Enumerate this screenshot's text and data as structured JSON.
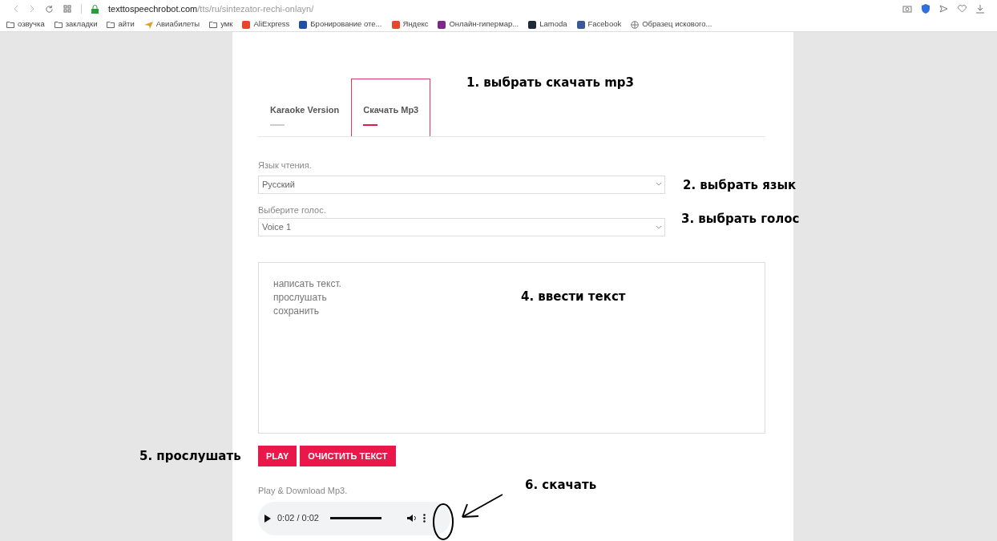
{
  "browser": {
    "url_host": "texttospeechrobot.com",
    "url_path": "/tts/ru/sintezator-rechi-onlayn/"
  },
  "bookmarks": [
    {
      "label": "озвучка",
      "kind": "folder"
    },
    {
      "label": "закладки",
      "kind": "folder"
    },
    {
      "label": "айти",
      "kind": "folder"
    },
    {
      "label": "Авиабилеты",
      "kind": "plane"
    },
    {
      "label": "умк",
      "kind": "folder"
    },
    {
      "label": "AliExpress",
      "kind": "site",
      "color": "#e8452c"
    },
    {
      "label": "Бронирование оте...",
      "kind": "site",
      "color": "#1e4fa3"
    },
    {
      "label": "Яндекс",
      "kind": "site",
      "color": "#e8452c"
    },
    {
      "label": "Онлайн-гипермар...",
      "kind": "site",
      "color": "#7b2a8c"
    },
    {
      "label": "Lamoda",
      "kind": "site",
      "color": "#1f2937"
    },
    {
      "label": "Facebook",
      "kind": "site",
      "color": "#3b5998"
    },
    {
      "label": "Образец искового...",
      "kind": "globe"
    }
  ],
  "tabs": [
    {
      "label": "Karaoke Version",
      "selected": false
    },
    {
      "label": "Скачать Mp3",
      "selected": true
    }
  ],
  "language": {
    "label": "Язык чтения.",
    "value": "Русский"
  },
  "voice": {
    "label": "Выберите голос.",
    "value": "Voice 1"
  },
  "text_area": {
    "value": "написать текст.\nпрослушать\nсохранить"
  },
  "buttons": [
    "PLAY",
    "ОЧИСТИТЬ ТЕКСТ"
  ],
  "player": {
    "label": "Play & Download Mp3.",
    "time": "0:02 / 0:02",
    "level": 1
  },
  "annotations": [
    "1. выбрать скачать mp3",
    "2. выбрать язык",
    "3. выбрать голос",
    "4. ввести текст",
    "5. прослушать",
    "6. скачать"
  ]
}
